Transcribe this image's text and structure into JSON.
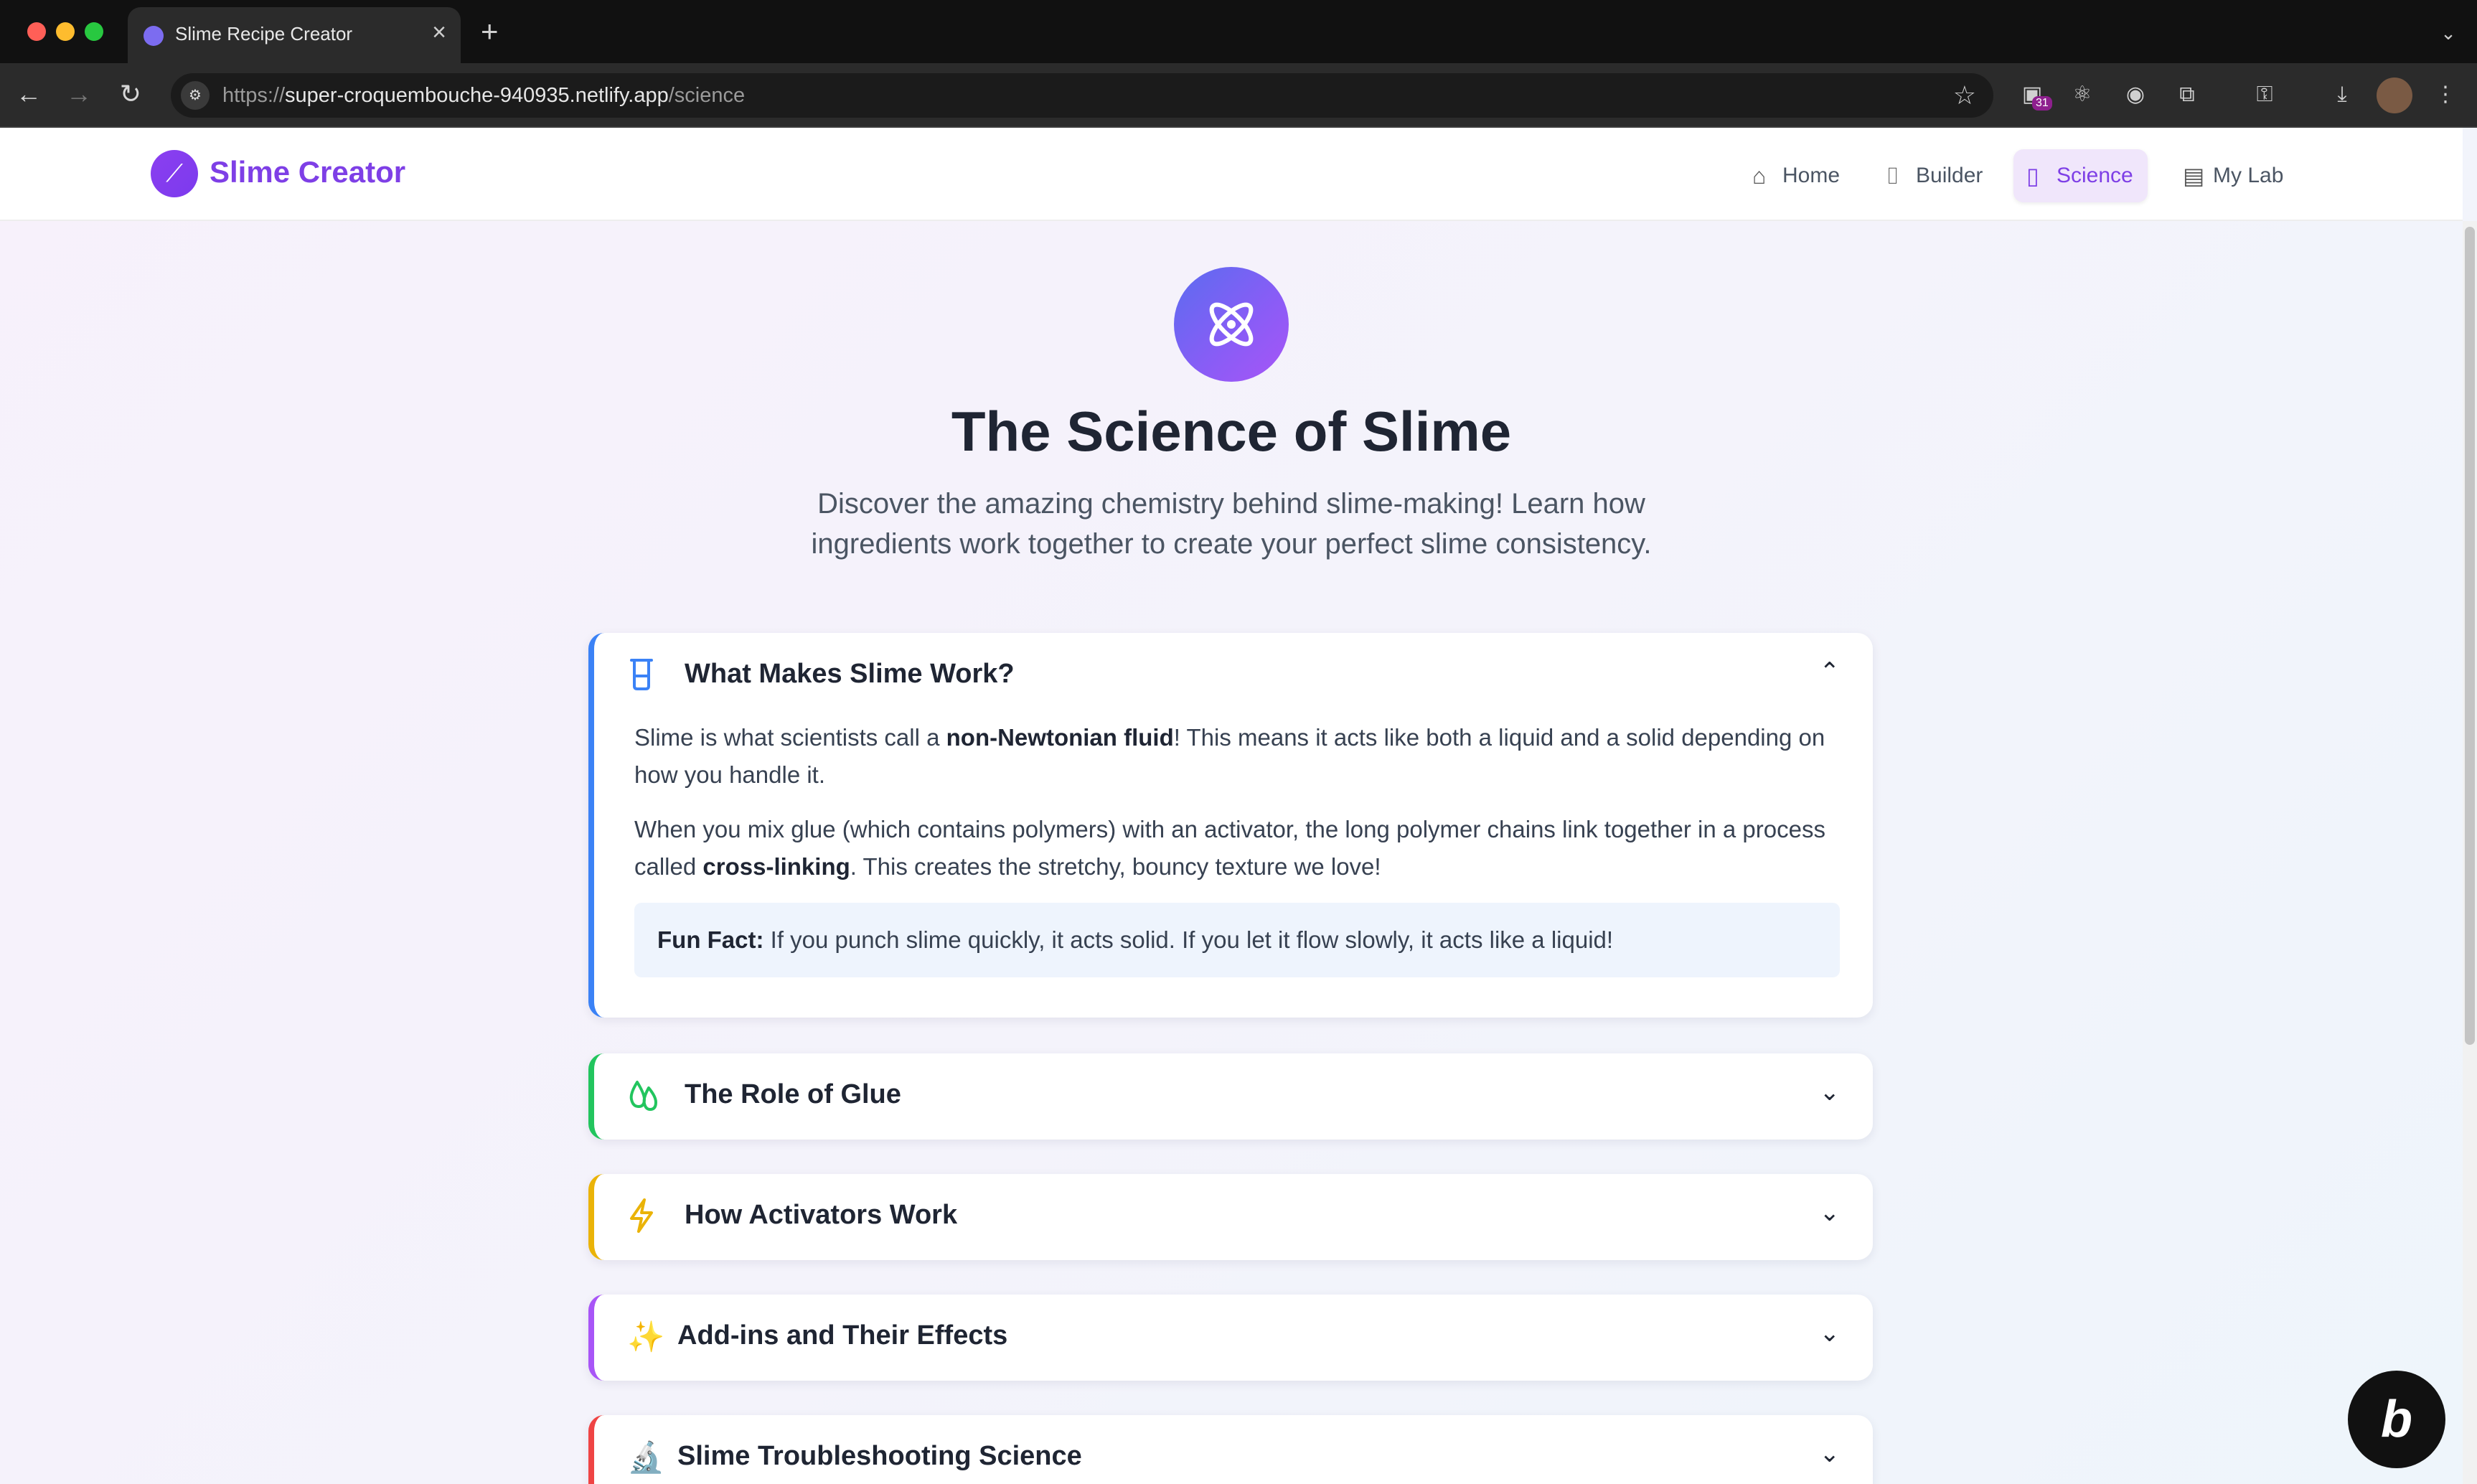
{
  "browser": {
    "tab_title": "Slime Recipe Creator",
    "tab_close": "×",
    "new_tab": "+",
    "url_protocol": "https://",
    "url_host": "super-croquembouche-940935.netlify.app",
    "url_path": "/science",
    "extension_badge": "31"
  },
  "app": {
    "brand": "Slime Creator",
    "nav": [
      {
        "label": "Home",
        "icon": "home-icon"
      },
      {
        "label": "Builder",
        "icon": "beaker-icon"
      },
      {
        "label": "Science",
        "icon": "book-open-icon",
        "active": true
      },
      {
        "label": "My Lab",
        "icon": "archive-icon"
      }
    ],
    "accent_color": "#7e3fe6"
  },
  "hero": {
    "icon": "atom-icon",
    "title": "The Science of Slime",
    "subtitle_line1": "Discover the amazing chemistry behind slime-making! Learn how",
    "subtitle_line2": "ingredients work together to create your perfect slime consistency."
  },
  "sections": [
    {
      "title": "What Makes Slime Work?",
      "icon": "beaker-icon",
      "expanded": true,
      "border_color": "#3b82f6",
      "p1_before": "Slime is what scientists call a ",
      "p1_bold": "non-Newtonian fluid",
      "p1_after": "! This means it acts like both a liquid and a solid depending on how you handle it.",
      "p2_before": "When you mix glue (which contains polymers) with an activator, the long polymer chains link together in a process called ",
      "p2_bold": "cross-linking",
      "p2_after": ". This creates the stretchy, bouncy texture we love!",
      "fun_label": "Fun Fact:",
      "fun_text": " If you punch slime quickly, it acts solid. If you let it flow slowly, it acts like a liquid!"
    },
    {
      "title": "The Role of Glue",
      "icon": "droplets-icon",
      "border_color": "#22c55e"
    },
    {
      "title": "How Activators Work",
      "icon": "zap-icon",
      "border_color": "#eab308"
    },
    {
      "title": "Add-ins and Their Effects",
      "icon": "sparkles-icon",
      "icon_glyph": "✨",
      "border_color": "#a855f7"
    },
    {
      "title": "Slime Troubleshooting Science",
      "icon": "microscope-icon",
      "icon_glyph": "🔬",
      "border_color": "#ef4444"
    }
  ]
}
